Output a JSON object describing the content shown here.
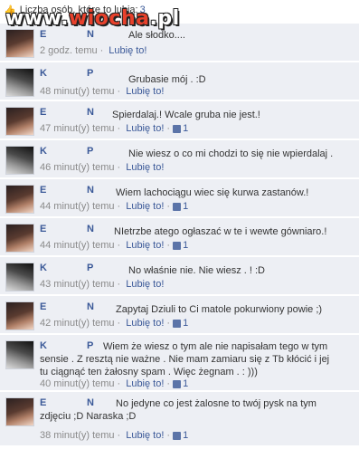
{
  "header": {
    "thumb_icon": "thumbs-up-icon",
    "label": "Liczba osób, które to lubią:",
    "count": "3"
  },
  "watermark": {
    "prefix": "www.",
    "accent": "wiocha",
    "suffix": ".pl"
  },
  "comments": [
    {
      "first": "E",
      "last": "N",
      "text": "Ale słodko....",
      "time": "2 godz. temu",
      "like": "Lubię to!",
      "likes": ""
    },
    {
      "first": "K",
      "last": "P",
      "text": "Grubasie mój . :D",
      "time": "48 minut(y) temu",
      "like": "Lubię to!",
      "likes": ""
    },
    {
      "first": "E",
      "last": "N",
      "text": "Spierdalaj.! Wcale gruba nie jest.!",
      "time": "47 minut(y) temu",
      "like": "Lubię to!",
      "likes": "1"
    },
    {
      "first": "K",
      "last": "P",
      "text": "Nie wiesz o co mi chodzi to się nie wpierdalaj .",
      "time": "46 minut(y) temu",
      "like": "Lubię to!",
      "likes": ""
    },
    {
      "first": "E",
      "last": "N",
      "text": "Wiem lachociągu wiec się kurwa zastanów.!",
      "time": "44 minut(y) temu",
      "like": "Lubię to!",
      "likes": "1"
    },
    {
      "first": "E",
      "last": "N",
      "text": "NIetrzbe atego ogłaszać w te i wewte gówniaro.!",
      "time": "44 minut(y) temu",
      "like": "Lubię to!",
      "likes": "1"
    },
    {
      "first": "K",
      "last": "P",
      "text": "No właśnie nie. Nie wiesz . ! :D",
      "time": "43 minut(y) temu",
      "like": "Lubię to!",
      "likes": ""
    },
    {
      "first": "E",
      "last": "N",
      "text": "Zapytaj Dziuli to Ci matole pokurwiony powie ;)",
      "time": "42 minut(y) temu",
      "like": "Lubię to!",
      "likes": "1"
    },
    {
      "first": "K",
      "last": "P",
      "text": "Wiem że wiesz o tym ale nie napisałam tego w tym sensie . Z resztą nie ważne . Nie mam zamiaru się z Tb kłócić i jej tu ciągnąć ten żałosny spam . Więc żegnam . : )))",
      "time": "40 minut(y) temu",
      "like": "Lubię to!",
      "likes": "1"
    },
    {
      "first": "E",
      "last": "N",
      "text": "No jedyne co jest żalosne to twój pysk na tym zdjęciu ;D Naraska ;D",
      "time": "38 minut(y) temu",
      "like": "Lubię to!",
      "likes": "1"
    }
  ]
}
